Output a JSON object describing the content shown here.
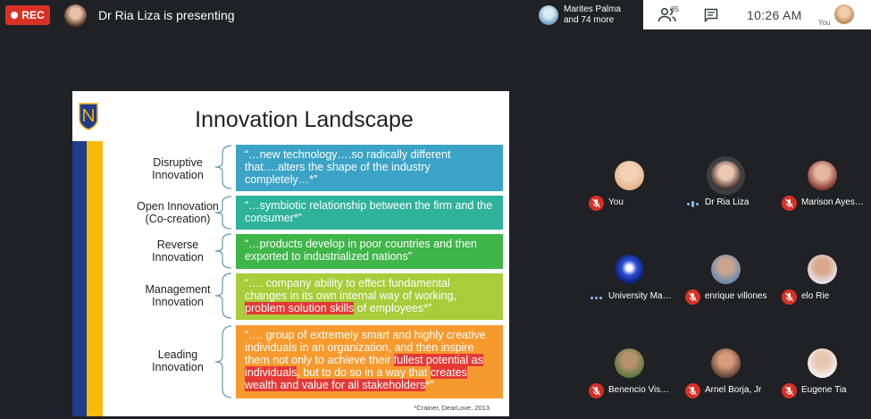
{
  "top_bar": {
    "rec_label": "REC",
    "presenting_text": "Dr Ria Liza is presenting",
    "participants_pill": {
      "line1": "Marites Palma",
      "line2": "and 74 more"
    },
    "people_count": "85",
    "clock": "10:26  AM",
    "you_label": "You"
  },
  "slide": {
    "title": "Innovation Landscape",
    "rows": [
      {
        "label_lines": [
          "Disruptive",
          "Innovation"
        ],
        "text_parts": [
          "“…new technology….so radically different that….alters the shape of the industry completely…*”"
        ],
        "box_color": "#3ba3c6"
      },
      {
        "label_lines": [
          "Open Innovation",
          "(Co-creation)"
        ],
        "text_parts": [
          "“…symbiotic relationship between the firm and the consumer*”"
        ],
        "box_color": "#2fb29b"
      },
      {
        "label_lines": [
          "Reverse",
          "Innovation"
        ],
        "text_parts": [
          "“…products develop in poor countries and then exported to industrialized nations”"
        ],
        "box_color": "#3fb54a"
      },
      {
        "label_lines": [
          "Management",
          "Innovation"
        ],
        "text_parts": [
          "“….  company ability to effect fundamental changes in its own internal way of working, ",
          "problem solution skills",
          " of employees*”"
        ],
        "box_color": "#a8cc3a"
      },
      {
        "label_lines": [
          "Leading",
          "Innovation"
        ],
        "text_parts": [
          "“….  group of extremely smart and highly creative individuals in an organization, and then inspire them not only to achieve their ",
          "fullest potential as individuals",
          ", but to do so in a way that ",
          "creates wealth and value for all stakeholders",
          "*”"
        ],
        "box_color": "#f79a2e"
      }
    ],
    "citation": "*Crainer, DearLove, 2013",
    "colors": {
      "stripe_blue": "#1f3b8c",
      "stripe_yellow": "#f8b90a",
      "highlight": "#e53935"
    }
  },
  "participants": [
    {
      "name": "You",
      "status": "muted",
      "avatar_color": "#e8b48a"
    },
    {
      "name": "Dr Ria Liza",
      "status": "speaking",
      "avatar_color": "#d7a48c"
    },
    {
      "name": "Marison Ayes…",
      "status": "muted",
      "avatar_color": "#c9876f"
    },
    {
      "name": "University Ma…",
      "status": "speaking",
      "avatar_color": "#2a4fd6"
    },
    {
      "name": "enrique villones",
      "status": "muted",
      "avatar_color": "#8b7d72"
    },
    {
      "name": "elo Rie",
      "status": "muted",
      "avatar_color": "#a07a6a"
    },
    {
      "name": "Benencio Vis…",
      "status": "muted",
      "avatar_color": "#6e8a4f"
    },
    {
      "name": "Arnel Borja, Jr",
      "status": "muted",
      "avatar_color": "#b07c62"
    },
    {
      "name": "Eugene Tia",
      "status": "muted",
      "avatar_color": "#d9c9bd"
    }
  ]
}
